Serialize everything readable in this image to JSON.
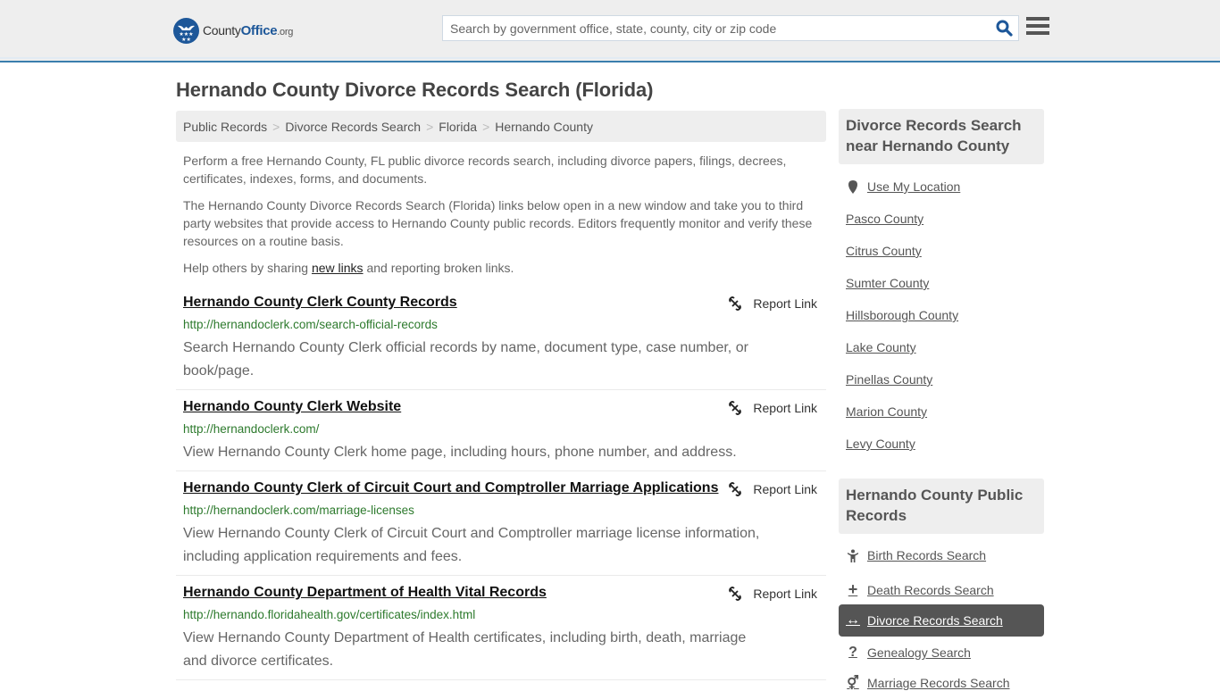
{
  "header": {
    "logo_main": "County",
    "logo_office": "Office",
    "logo_org": ".org",
    "search_placeholder": "Search by government office, state, county, city or zip code",
    "accent_color": "#1d5799"
  },
  "page_title": "Hernando County Divorce Records Search (Florida)",
  "breadcrumb": [
    {
      "label": "Public Records"
    },
    {
      "label": "Divorce Records Search"
    },
    {
      "label": "Florida"
    },
    {
      "label": "Hernando County"
    }
  ],
  "breadcrumb_separator": ">",
  "intro": {
    "p1": "Perform a free Hernando County, FL public divorce records search, including divorce papers, filings, decrees, certificates, indexes, forms, and documents.",
    "p2": "The Hernando County Divorce Records Search (Florida) links below open in a new window and take you to third party websites that provide access to Hernando County public records. Editors frequently monitor and verify these resources on a routine basis.",
    "p3_before": "Help others by sharing ",
    "p3_link": "new links",
    "p3_after": " and reporting broken links."
  },
  "listings": [
    {
      "title": "Hernando County Clerk County Records",
      "url": "http://hernandoclerk.com/search-official-records",
      "description": "Search Hernando County Clerk official records by name, document type, case number, or book/page.",
      "report_label": "Report Link"
    },
    {
      "title": "Hernando County Clerk Website",
      "url": "http://hernandoclerk.com/",
      "description": "View Hernando County Clerk home page, including hours, phone number, and address.",
      "report_label": "Report Link"
    },
    {
      "title": "Hernando County Clerk of Circuit Court and Comptroller Marriage Applications",
      "url": "http://hernandoclerk.com/marriage-licenses",
      "description": "View Hernando County Clerk of Circuit Court and Comptroller marriage license information, including application requirements and fees.",
      "report_label": "Report Link"
    },
    {
      "title": "Hernando County Department of Health Vital Records",
      "url": "http://hernando.floridahealth.gov/certificates/index.html",
      "description": "View Hernando County Department of Health certificates, including birth, death, marriage and divorce certificates.",
      "report_label": "Report Link"
    }
  ],
  "sidebar": {
    "nearby_heading": "Divorce Records Search near Hernando County",
    "use_location": "Use My Location",
    "nearby": [
      "Pasco County",
      "Citrus County",
      "Sumter County",
      "Hillsborough County",
      "Lake County",
      "Pinellas County",
      "Marion County",
      "Levy County"
    ],
    "public_heading": "Hernando County Public Records",
    "public_records": [
      {
        "label": "Birth Records Search",
        "icon": "child-icon",
        "glyph": "†"
      },
      {
        "label": "Death Records Search",
        "icon": "plus-icon",
        "glyph": "+"
      },
      {
        "label": "Divorce Records Search",
        "icon": "arrows-horizontal-icon",
        "glyph": "↔",
        "active": true
      },
      {
        "label": "Genealogy Search",
        "icon": "question-icon",
        "glyph": "?"
      },
      {
        "label": "Marriage Records Search",
        "icon": "gender-symbols-icon",
        "glyph": "⚥"
      }
    ]
  }
}
